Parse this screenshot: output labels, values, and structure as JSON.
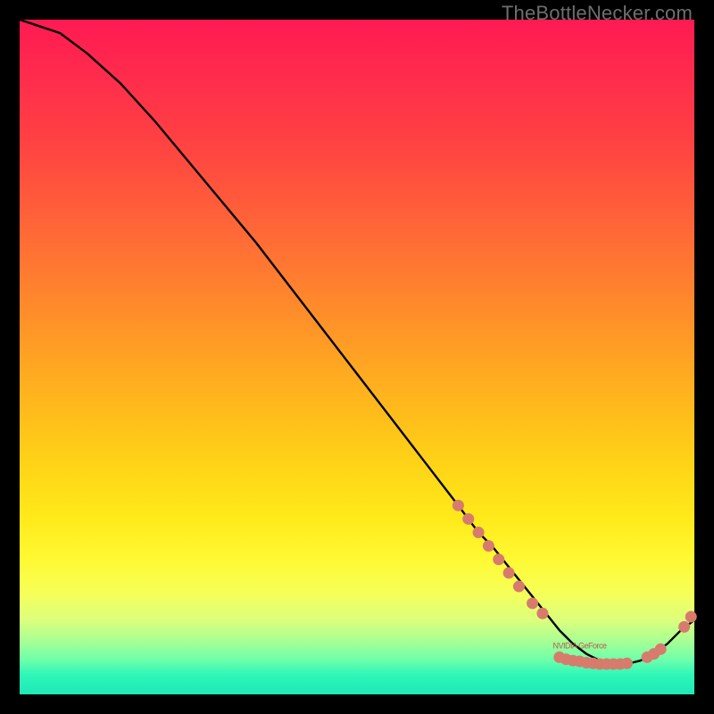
{
  "watermark": "TheBottleNecker.com",
  "colors": {
    "background": "#000000",
    "curve": "#000000",
    "marker": "#D77B6C",
    "watermark": "#6e6e6e"
  },
  "chart_data": {
    "type": "line",
    "title": "",
    "xlabel": "",
    "ylabel": "",
    "xlim": [
      0,
      100
    ],
    "ylim": [
      0,
      100
    ],
    "series": [
      {
        "name": "curve",
        "x": [
          0,
          3,
          6,
          10,
          15,
          20,
          25,
          30,
          35,
          40,
          45,
          50,
          55,
          60,
          65,
          68,
          70,
          72,
          74,
          76,
          78,
          80,
          82,
          84,
          86,
          88,
          90,
          92,
          94,
          96,
          98,
          100
        ],
        "y": [
          100,
          99,
          98,
          95,
          90.5,
          85,
          79,
          73,
          67,
          60.5,
          54,
          47.5,
          41,
          34.5,
          28,
          24,
          22,
          19.5,
          17,
          14.5,
          12,
          9.5,
          7.5,
          6,
          5,
          4.5,
          4.5,
          5,
          6,
          7.5,
          9.5,
          11
        ]
      }
    ],
    "markers": [
      {
        "x": 65,
        "y": 28
      },
      {
        "x": 66.5,
        "y": 26
      },
      {
        "x": 68,
        "y": 24
      },
      {
        "x": 69.5,
        "y": 22
      },
      {
        "x": 71,
        "y": 20
      },
      {
        "x": 72.5,
        "y": 18
      },
      {
        "x": 74,
        "y": 16
      },
      {
        "x": 76,
        "y": 13.5
      },
      {
        "x": 77.5,
        "y": 12
      },
      {
        "x": 80,
        "y": 5.5
      },
      {
        "x": 81,
        "y": 5.2
      },
      {
        "x": 82,
        "y": 5
      },
      {
        "x": 83,
        "y": 4.9
      },
      {
        "x": 84,
        "y": 4.7
      },
      {
        "x": 85,
        "y": 4.6
      },
      {
        "x": 86,
        "y": 4.5
      },
      {
        "x": 87,
        "y": 4.5
      },
      {
        "x": 88,
        "y": 4.5
      },
      {
        "x": 89,
        "y": 4.5
      },
      {
        "x": 90,
        "y": 4.6
      },
      {
        "x": 93,
        "y": 5.5
      },
      {
        "x": 94,
        "y": 6
      },
      {
        "x": 95,
        "y": 6.7
      },
      {
        "x": 98.5,
        "y": 10
      },
      {
        "x": 99.5,
        "y": 11.5
      }
    ],
    "annotations": [
      {
        "text": "NVIDIA GeForce",
        "x": 83,
        "y": 6.8
      }
    ],
    "gradient_stops": [
      {
        "pos": 0.0,
        "color": "#ff1a52"
      },
      {
        "pos": 0.5,
        "color": "#ffb024"
      },
      {
        "pos": 0.8,
        "color": "#fff933"
      },
      {
        "pos": 1.0,
        "color": "#1de9b6"
      }
    ]
  }
}
